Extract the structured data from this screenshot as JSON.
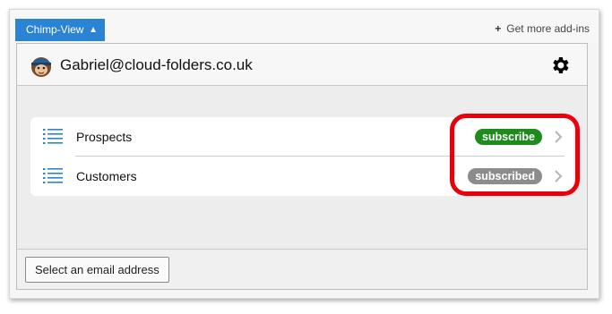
{
  "tabbar": {
    "tab_label": "Chimp-View",
    "tab_chevron_icon": "chevron-up-icon",
    "get_more_label": "Get more add-ins",
    "get_more_icon": "plus-icon"
  },
  "header": {
    "avatar_icon": "mailchimp-avatar-icon",
    "email": "Gabriel@cloud-folders.co.uk",
    "settings_icon": "gear-icon"
  },
  "lists": {
    "items": [
      {
        "label": "Prospects",
        "status": "subscribe",
        "status_color": "#1d8c1d"
      },
      {
        "label": "Customers",
        "status": "subscribed",
        "status_color": "#8c8c8c"
      }
    ]
  },
  "footer": {
    "select_button_label": "Select an email address"
  },
  "colors": {
    "tab_accent": "#2b84d3",
    "highlight": "#e8000b"
  }
}
